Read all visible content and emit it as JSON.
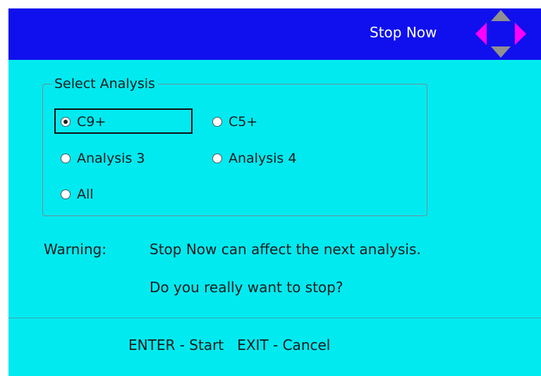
{
  "header": {
    "title": "Stop Now",
    "background": "#1010ee",
    "nav_icon": "four-way-arrow-icon"
  },
  "analysis_group": {
    "legend": "Select Analysis",
    "selected": "C9+",
    "options": [
      {
        "label": "C9+",
        "checked": true
      },
      {
        "label": "C5+",
        "checked": false
      },
      {
        "label": "Analysis 3",
        "checked": false
      },
      {
        "label": "Analysis 4",
        "checked": false
      },
      {
        "label": "All",
        "checked": false
      }
    ]
  },
  "warning": {
    "label": "Warning:",
    "line1": "Stop Now can affect the next analysis.",
    "line2": "Do you really want to stop?"
  },
  "footer": {
    "hint": "ENTER - Start   EXIT - Cancel"
  },
  "colors": {
    "screen_background": "#00eaf0",
    "header_background": "#1010ee",
    "arrow_active": "#ff00ff",
    "arrow_inactive": "#909090"
  }
}
